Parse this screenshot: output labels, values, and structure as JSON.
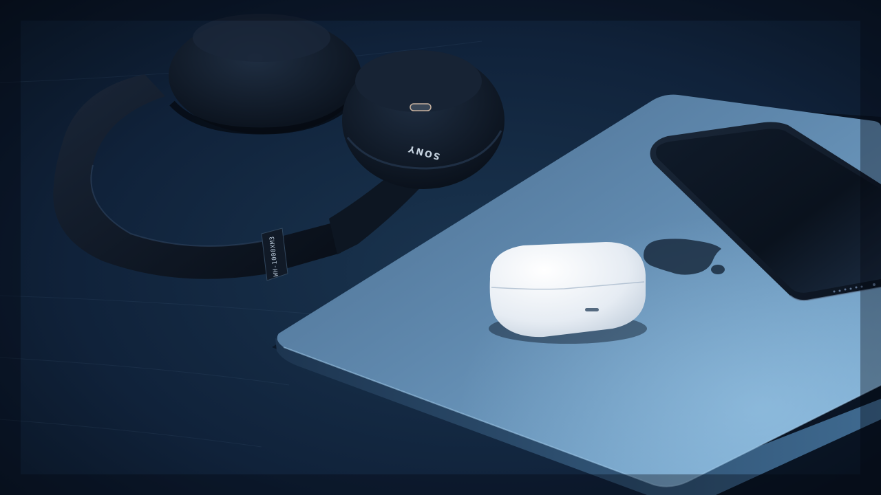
{
  "headphones": {
    "brand": "SONY",
    "model": "WH-1000XM3"
  },
  "colors": {
    "table_dark": "#08121f",
    "table_mid": "#14283f",
    "laptop_light": "#6b98bd",
    "laptop_dark": "#2a4a68",
    "earbud_case": "#eef2f6",
    "phone_screen": "#0c1522",
    "headphone_black": "#0d1520"
  }
}
